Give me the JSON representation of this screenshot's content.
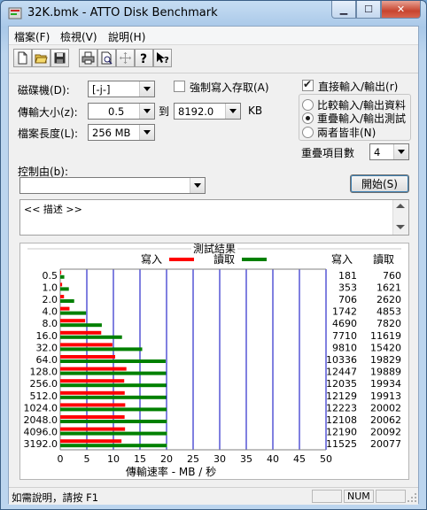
{
  "window": {
    "title": "32K.bmk - ATTO Disk Benchmark"
  },
  "menu": {
    "items": [
      "檔案(F)",
      "檢視(V)",
      "說明(H)"
    ]
  },
  "controls": {
    "drive_label": "磁碟機(D):",
    "drive_value": "[-j-]",
    "force_write_label": "強制寫入存取(A)",
    "force_write_checked": false,
    "direct_io_label": "直接輸入/輸出(r)",
    "direct_io_checked": true,
    "transfer_size_label": "傳輸大小(z):",
    "transfer_from": "0.5",
    "to_label": "到",
    "transfer_to": "8192.0",
    "kb_label": "KB",
    "file_length_label": "檔案長度(L):",
    "file_length_value": "256 MB",
    "io_options": [
      "比較輸入/輸出資料",
      "重疊輸入/輸出測試",
      "兩者皆非(N)"
    ],
    "io_selected": 1,
    "queue_depth_label": "重疊項目數",
    "queue_depth_value": "4",
    "controlled_by_label": "控制由(b):",
    "controlled_by_value": "",
    "start_button": "開始(S)",
    "description_text": "<<    描述    >>"
  },
  "results": {
    "title": "測試結果",
    "write_legend": "寫入",
    "read_legend": "讀取",
    "write_header": "寫入",
    "read_header": "讀取",
    "write_color": "#ff0000",
    "read_color": "#008000"
  },
  "chart_data": {
    "type": "bar",
    "orientation": "horizontal",
    "categories": [
      "0.5",
      "1.0",
      "2.0",
      "4.0",
      "8.0",
      "16.0",
      "32.0",
      "64.0",
      "128.0",
      "256.0",
      "512.0",
      "1024.0",
      "2048.0",
      "4096.0",
      "3192.0"
    ],
    "series": [
      {
        "name": "寫入",
        "values": [
          181,
          353,
          706,
          1742,
          4690,
          7710,
          9810,
          10336,
          12447,
          12035,
          12129,
          12223,
          12108,
          12190,
          11525
        ]
      },
      {
        "name": "讀取",
        "values": [
          760,
          1621,
          2620,
          4853,
          7820,
          11619,
          15420,
          19829,
          19889,
          19934,
          19913,
          20002,
          20062,
          20092,
          20077
        ]
      }
    ],
    "xlabel": "傳輸速率 - MB / 秒",
    "xticks": [
      0,
      5,
      10,
      15,
      20,
      25,
      30,
      35,
      40,
      45,
      50
    ],
    "xlim": [
      0,
      50
    ],
    "grid": true
  },
  "status": {
    "help_text": "如需說明，請按 F1",
    "num": "NUM"
  }
}
